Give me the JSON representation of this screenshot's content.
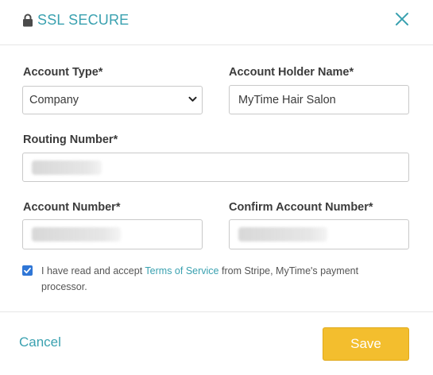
{
  "header": {
    "title": "SSL SECURE",
    "lock_icon": "lock-icon",
    "close_icon": "close-icon"
  },
  "form": {
    "account_type": {
      "label": "Account Type*",
      "selected": "Company"
    },
    "account_holder_name": {
      "label": "Account Holder Name*",
      "value": "MyTime Hair Salon"
    },
    "routing_number": {
      "label": "Routing Number*"
    },
    "account_number": {
      "label": "Account Number*"
    },
    "confirm_account_number": {
      "label": "Confirm Account Number*"
    }
  },
  "terms": {
    "checked": true,
    "prefix": "I have read and accept ",
    "link_text": "Terms of Service",
    "suffix": " from Stripe, MyTime's payment processor."
  },
  "footer": {
    "cancel_label": "Cancel",
    "save_label": "Save"
  },
  "colors": {
    "accent": "#3aa1b0",
    "save_button": "#f3be2e",
    "checkbox": "#2f76d6"
  }
}
